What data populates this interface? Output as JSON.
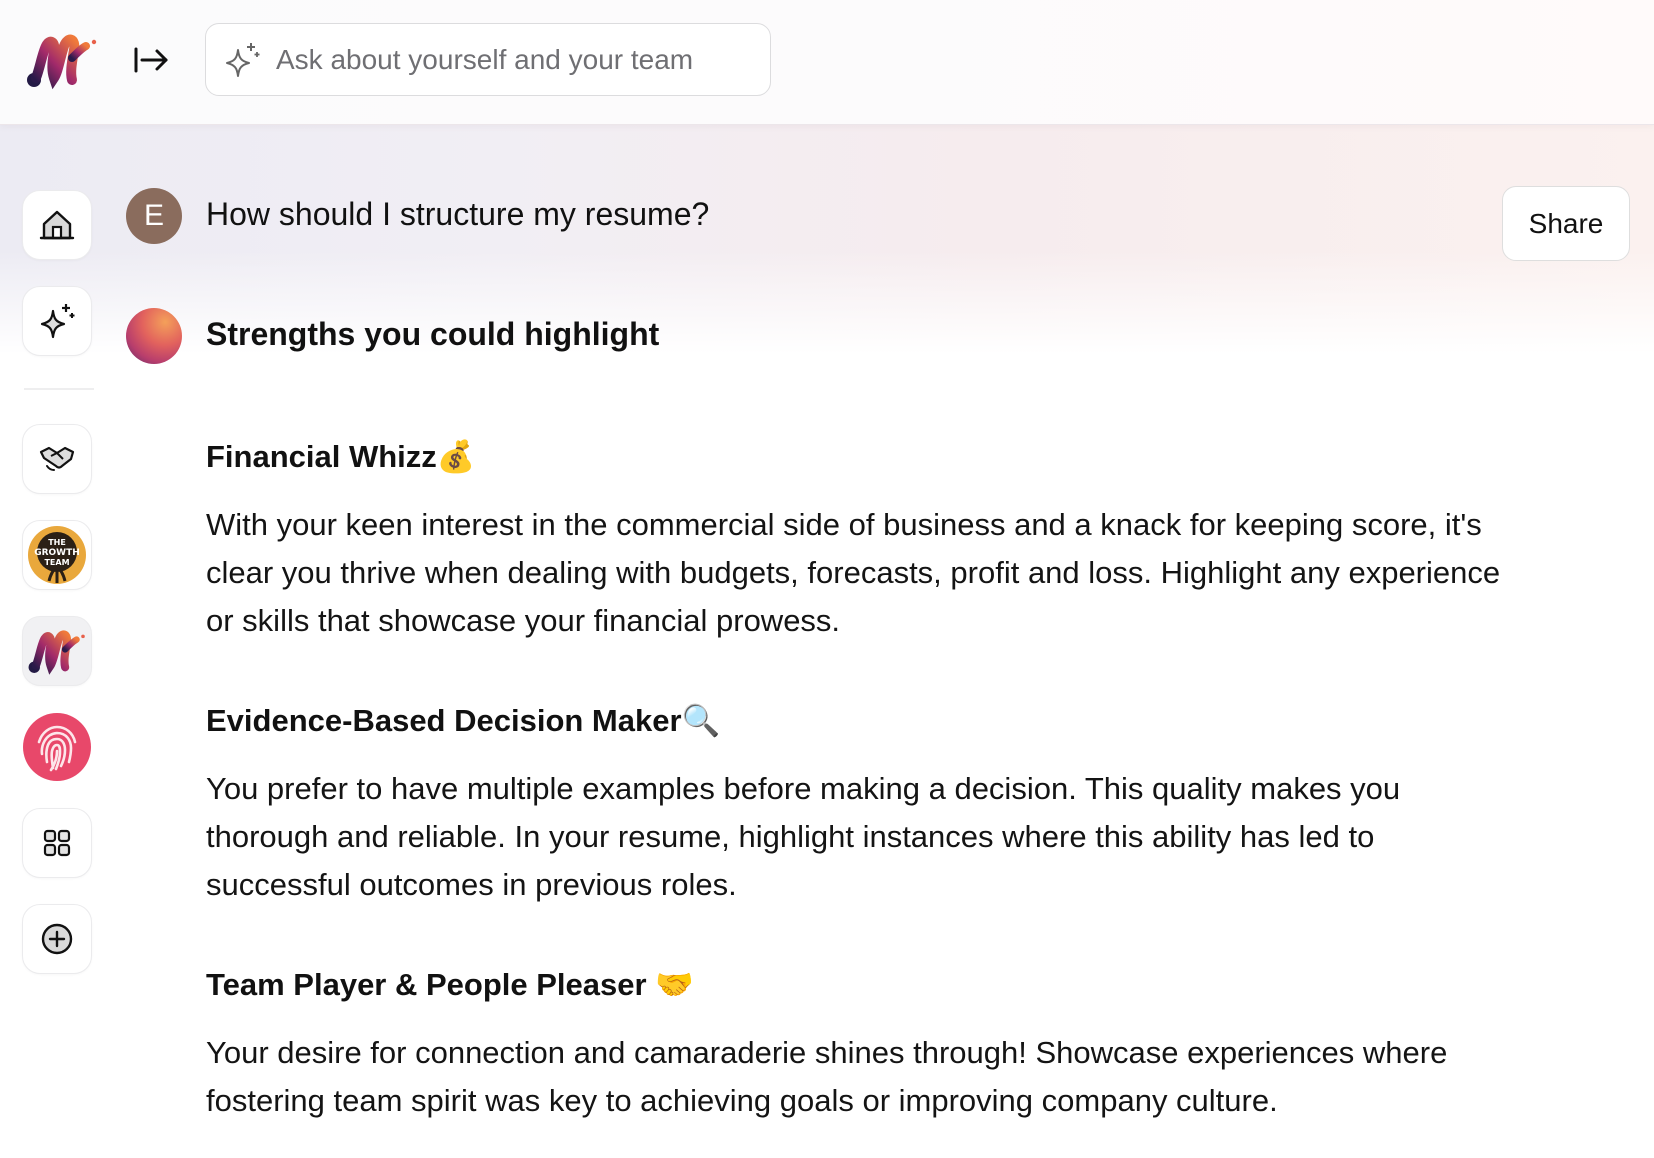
{
  "header": {
    "logo_name": "M",
    "collapse_icon": "arrow-right-to-bar-icon",
    "search": {
      "placeholder": "Ask about yourself and your team",
      "value": "",
      "icon": "sparkle-icon"
    }
  },
  "sidebar": {
    "items": [
      {
        "name": "home",
        "icon": "home-icon"
      },
      {
        "name": "ask-ai",
        "icon": "sparkle-icon"
      },
      {
        "name": "teams",
        "icon": "handshake-icon"
      },
      {
        "name": "the-growth-team",
        "icon": "growth-team-logo",
        "label": "THE GROWTH TEAM"
      },
      {
        "name": "m-workspace",
        "icon": "m-logo"
      },
      {
        "name": "fingerprint",
        "icon": "fingerprint-icon",
        "color": "#e8486a"
      },
      {
        "name": "apps",
        "icon": "grid-icon"
      },
      {
        "name": "add",
        "icon": "plus-circle-icon"
      }
    ]
  },
  "conversation": {
    "user": {
      "avatar_initial": "E",
      "avatar_color": "#8a6c5d",
      "question": "How should I structure my resume?"
    },
    "share_label": "Share",
    "assistant": {
      "title": "Strengths you could highlight",
      "sections": [
        {
          "heading": "Financial Whizz",
          "emoji": "💰",
          "body": "With your keen interest in the commercial side of business and a knack for keeping score, it's clear you thrive when dealing with budgets, forecasts, profit and loss. Highlight any experience or skills that showcase your financial prowess."
        },
        {
          "heading": "Evidence-Based Decision Maker",
          "emoji": "🔍",
          "body": "You prefer to have multiple examples before making a decision. This quality makes you thorough and reliable. In your resume, highlight instances where this ability has led to successful outcomes in previous roles."
        },
        {
          "heading": "Team Player & People Pleaser",
          "emoji": "🤝",
          "body": "Your desire for connection and camaraderie shines through! Showcase experiences where fostering team spirit was key to achieving goals or improving company culture."
        }
      ]
    }
  }
}
